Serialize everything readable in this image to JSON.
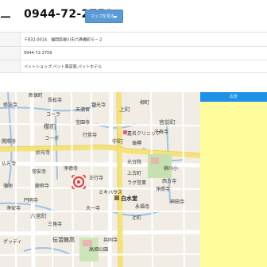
{
  "header": {
    "dash": "ー",
    "phone": "0944-72-2759",
    "map_button_label": "マップを見る"
  },
  "info": {
    "address": "〒832-0014　福岡県柳川市六斉棚町６－２",
    "tel": "0944-72-2759",
    "category": "ペットショップ,ペット美容室,ペットホテル"
  },
  "ad": {
    "header": "広告"
  },
  "map": {
    "labels": {
      "shinhoroji": "新保町",
      "kushifu": "櫛町",
      "uraki": "上町",
      "miyamaecho": "宮前町",
      "yamateimachi": "柳町",
      "naka": "中町",
      "chosho": "長松寺",
      "tenmangu": "天満宮",
      "hoenji": "宝園寺",
      "shuho": "修法寺",
      "kaisho": "開照寺",
      "myoko": "妙光寺",
      "gyokaku": "行覚寺",
      "bukko": "仏光寺",
      "joan": "常安寺",
      "ryusho": "龍称寺",
      "enmyo": "円明寺",
      "kengoko": "顕光寺",
      "shojo": "正行寺",
      "tsukushi": "千寿寺",
      "yanagawa_clinic": "嘉名クリニック",
      "kodaiin": "光台院",
      "yanagawa_school": "柳川小",
      "nishikata": "西方寺",
      "josho": "浄照寺",
      "kandaji": "神田寺",
      "joanji2": "浄安寺",
      "daiichi": "大一寺",
      "misaki": "三角寺",
      "mikihouse": "ミキハウス",
      "hakusuido": "白水堂",
      "kochoo": "上古町",
      "tsujimachi": "辻町",
      "eikeiji": "永福寺",
      "jitokuji": "浄徳寺",
      "nonaka": "六宮町",
      "dengen": "伝習館高",
      "takahata": "高畑公園",
      "kanbe": "共同寺",
      "kamado": "蒲池",
      "goodday": "グッディ",
      "coalmart": "コーポ",
      "lawsonA": "コーラ",
      "pets": "ラグ営業",
      "kamedaru": "龜樽"
    }
  }
}
